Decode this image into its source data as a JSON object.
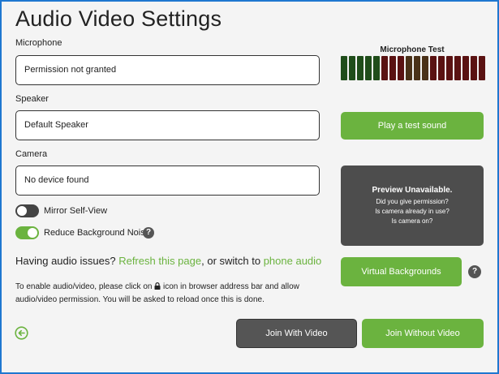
{
  "title": "Audio Video Settings",
  "microphone": {
    "label": "Microphone",
    "value": "Permission not granted"
  },
  "speaker": {
    "label": "Speaker",
    "value": "Default Speaker"
  },
  "camera": {
    "label": "Camera",
    "value": "No device found"
  },
  "toggles": {
    "mirror": {
      "label": "Mirror Self-View",
      "state": "off"
    },
    "noise": {
      "label": "Reduce Background Noise",
      "state": "on"
    }
  },
  "issues": {
    "prefix": "Having audio issues?",
    "refresh_link": "Refresh this page",
    "middle": ",  or switch to",
    "phone_link": "phone audio"
  },
  "instructions": {
    "before_icon": "To enable audio/video, please click on",
    "after_icon": "icon in browser address bar and allow audio/video permission. You will be asked to reload once this is done."
  },
  "mic_test": {
    "title": "Microphone Test",
    "bar_colors": [
      "#1f4d1a",
      "#1f4d1a",
      "#1f4d1a",
      "#1f4d1a",
      "#1f4d1a",
      "#5a1212",
      "#5a1212",
      "#5a1212",
      "#4a3118",
      "#4a3118",
      "#4a3118",
      "#5a1212",
      "#5a1212",
      "#5a1212",
      "#5a1212",
      "#5a1212",
      "#5a1212",
      "#5a1212"
    ]
  },
  "buttons": {
    "test_sound": "Play a test sound",
    "virtual_bg": "Virtual Backgrounds",
    "join_video": "Join With Video",
    "join_no_video": "Join Without Video"
  },
  "preview": {
    "heading": "Preview Unavailable.",
    "lines": [
      "Did you give permission?",
      "Is camera already in use?",
      "Is camera on?"
    ]
  },
  "help_glyph": "?",
  "colors": {
    "accent": "#6bb33f",
    "dark": "#4d4d4d",
    "frame": "#1f77d0"
  }
}
